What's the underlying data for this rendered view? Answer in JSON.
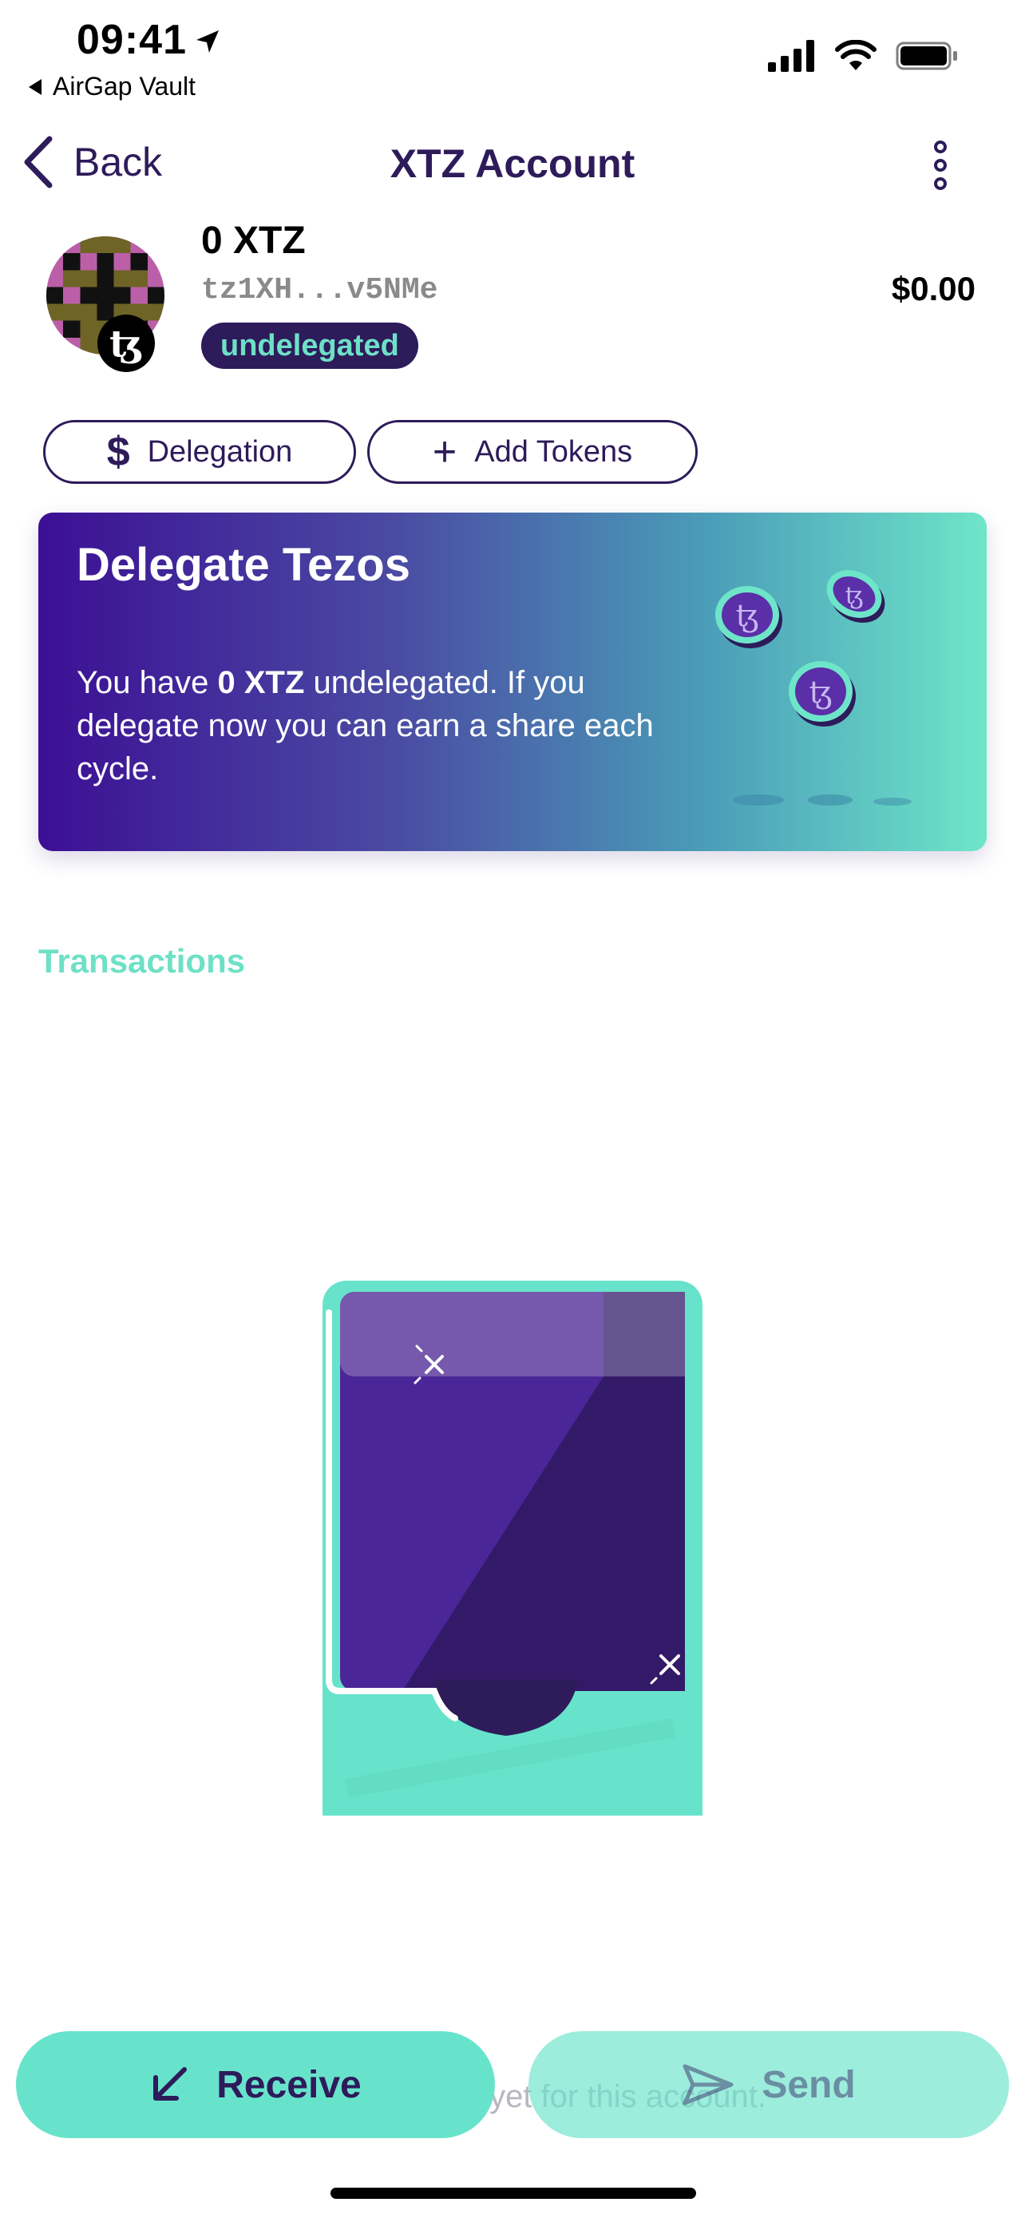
{
  "status_bar": {
    "time": "09:41",
    "back_app_label": "AirGap Vault",
    "icons": [
      "location-arrow-icon",
      "cellular-signal-icon",
      "wifi-icon",
      "battery-icon"
    ]
  },
  "nav": {
    "back_label": "Back",
    "title": "XTZ Account",
    "more_icon": "more-vertical-icon"
  },
  "account": {
    "balance": "0 XTZ",
    "address": "tz1XH...v5NMe",
    "status": "undelegated",
    "fiat_value": "$0.00",
    "badge_symbol": "ꜩ"
  },
  "actions": {
    "delegation_symbol": "$",
    "delegation_label": "Delegation",
    "add_tokens_symbol": "+",
    "add_tokens_label": "Add Tokens"
  },
  "banner": {
    "title": "Delegate Tezos",
    "text_prefix": "You have ",
    "text_amount": "0 XTZ",
    "text_suffix": " undelegated. If you delegate now you can earn a share each cycle."
  },
  "transactions": {
    "title": "Transactions",
    "empty_text": "No transactions yet for this account."
  },
  "bottom": {
    "receive_label": "Receive",
    "send_label": "Send"
  },
  "colors": {
    "primary": "#2d1b5a",
    "accent": "#68e3cb",
    "banner_start": "#3c0f94",
    "banner_end": "#6ee5c9"
  }
}
